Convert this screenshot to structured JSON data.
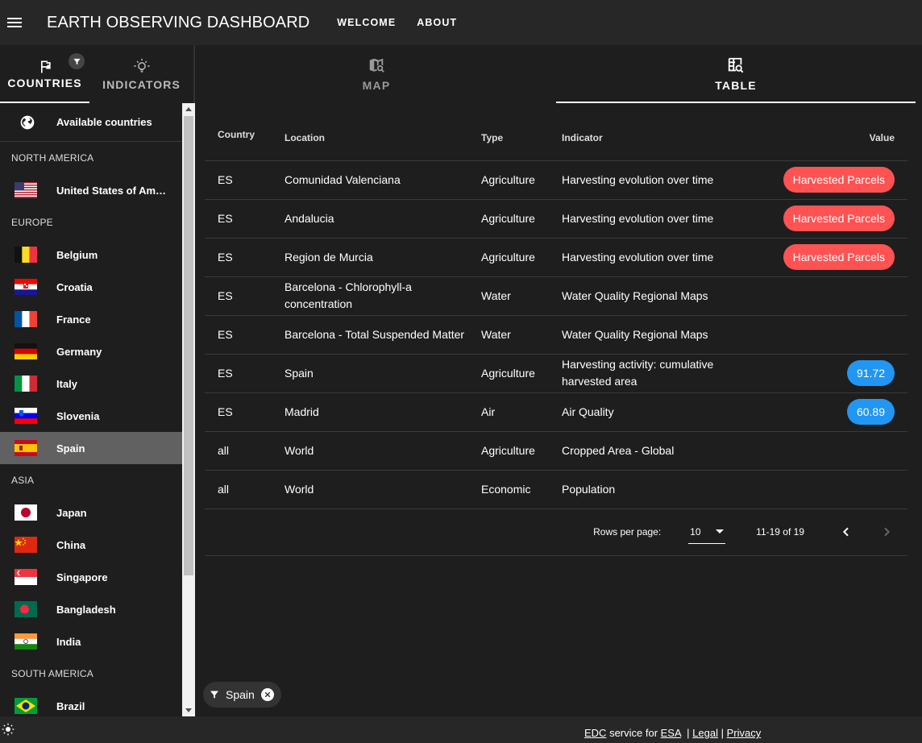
{
  "app": {
    "title": "EARTH OBSERVING DASHBOARD"
  },
  "nav": {
    "welcome": "WELCOME",
    "about": "ABOUT"
  },
  "left_tabs": {
    "countries": "COUNTRIES",
    "indicators": "INDICATORS"
  },
  "countries_list": {
    "available_label": "Available countries",
    "regions": [
      {
        "name": "NORTH AMERICA",
        "countries": [
          {
            "name": "United States of America",
            "flag": "us"
          }
        ]
      },
      {
        "name": "EUROPE",
        "countries": [
          {
            "name": "Belgium",
            "flag": "be"
          },
          {
            "name": "Croatia",
            "flag": "hr"
          },
          {
            "name": "France",
            "flag": "fr"
          },
          {
            "name": "Germany",
            "flag": "de"
          },
          {
            "name": "Italy",
            "flag": "it"
          },
          {
            "name": "Slovenia",
            "flag": "si"
          },
          {
            "name": "Spain",
            "flag": "es"
          }
        ]
      },
      {
        "name": "ASIA",
        "countries": [
          {
            "name": "Japan",
            "flag": "jp"
          },
          {
            "name": "China",
            "flag": "cn"
          },
          {
            "name": "Singapore",
            "flag": "sg"
          },
          {
            "name": "Bangladesh",
            "flag": "bd"
          },
          {
            "name": "India",
            "flag": "in"
          }
        ]
      },
      {
        "name": "SOUTH AMERICA",
        "countries": [
          {
            "name": "Brazil",
            "flag": "br"
          }
        ]
      }
    ],
    "selected": "Spain"
  },
  "main_tabs": {
    "map": "MAP",
    "table": "TABLE"
  },
  "table": {
    "headers": {
      "country": "Country",
      "location": "Location",
      "type": "Type",
      "indicator": "Indicator",
      "value": "Value"
    },
    "rows": [
      {
        "country": "ES",
        "location": "Comunidad Valenciana",
        "type": "Agriculture",
        "indicator": "Harvesting evolution over time",
        "value": "Harvested Parcels",
        "value_style": "red"
      },
      {
        "country": "ES",
        "location": "Andalucia",
        "type": "Agriculture",
        "indicator": "Harvesting evolution over time",
        "value": "Harvested Parcels",
        "value_style": "red"
      },
      {
        "country": "ES",
        "location": "Region de Murcia",
        "type": "Agriculture",
        "indicator": "Harvesting evolution over time",
        "value": "Harvested Parcels",
        "value_style": "red"
      },
      {
        "country": "ES",
        "location": "Barcelona - Chlorophyll-a concentration",
        "type": "Water",
        "indicator": "Water Quality Regional Maps",
        "value": "",
        "value_style": ""
      },
      {
        "country": "ES",
        "location": "Barcelona - Total Suspended Matter",
        "type": "Water",
        "indicator": "Water Quality Regional Maps",
        "value": "",
        "value_style": ""
      },
      {
        "country": "ES",
        "location": "Spain",
        "type": "Agriculture",
        "indicator": "Harvesting activity: cumulative harvested area",
        "value": "91.72",
        "value_style": "blue"
      },
      {
        "country": "ES",
        "location": "Madrid",
        "type": "Air",
        "indicator": "Air Quality",
        "value": "60.89",
        "value_style": "blue"
      },
      {
        "country": "all",
        "location": "World",
        "type": "Agriculture",
        "indicator": "Cropped Area - Global",
        "value": "",
        "value_style": ""
      },
      {
        "country": "all",
        "location": "World",
        "type": "Economic",
        "indicator": "Population",
        "value": "",
        "value_style": ""
      }
    ],
    "pagination": {
      "rows_per_page_label": "Rows per page:",
      "rows_per_page": "10",
      "range": "11-19 of 19"
    }
  },
  "filter_chip": {
    "label": "Spain"
  },
  "footer": {
    "edc": "EDC",
    "service_for": " service for ",
    "esa": "ESA",
    "sep1": "  | ",
    "legal": "Legal",
    "sep2": " | ",
    "privacy": "Privacy"
  },
  "colors": {
    "chip_red": "#ff5252",
    "chip_blue": "#2196f3",
    "selected_row": "#616161"
  },
  "icons": {
    "menu": "menu-icon",
    "flag": "flag-icon",
    "filter": "filter-icon",
    "bulb": "lightbulb-icon",
    "globe": "globe-icon",
    "map": "map-search-icon",
    "table": "table-search-icon",
    "theme": "brightness-icon"
  }
}
